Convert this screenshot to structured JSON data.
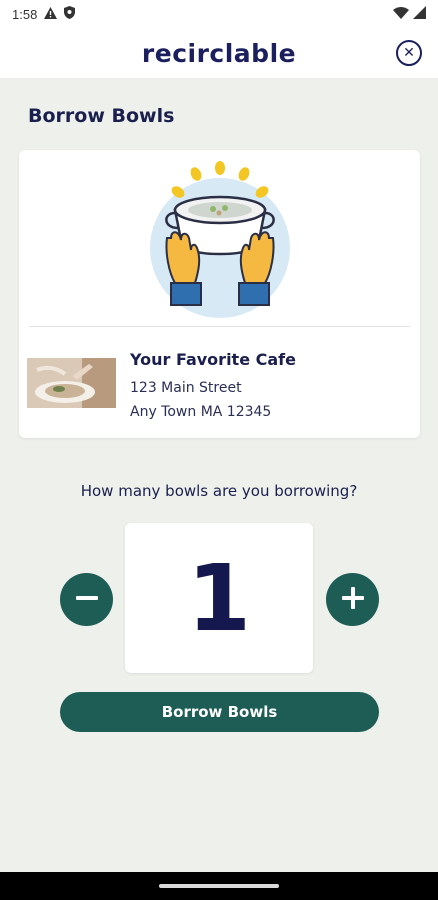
{
  "status_bar": {
    "time": "1:58",
    "icons": [
      "alert-icon",
      "shield-icon",
      "wifi-icon",
      "signal-icon"
    ]
  },
  "header": {
    "logo": "recirclable",
    "close_icon": "close-icon"
  },
  "page": {
    "title": "Borrow Bowls"
  },
  "cafe": {
    "name": "Your Favorite Cafe",
    "address_line1": "123 Main Street",
    "address_line2": "Any Town MA 12345"
  },
  "quantity": {
    "question": "How many bowls are you borrowing?",
    "value": "1",
    "decrement_icon": "minus-icon",
    "increment_icon": "plus-icon"
  },
  "actions": {
    "borrow_label": "Borrow Bowls"
  },
  "colors": {
    "accent": "#1d5d55",
    "brand": "#1b1f5e",
    "background": "#eef0ec"
  }
}
